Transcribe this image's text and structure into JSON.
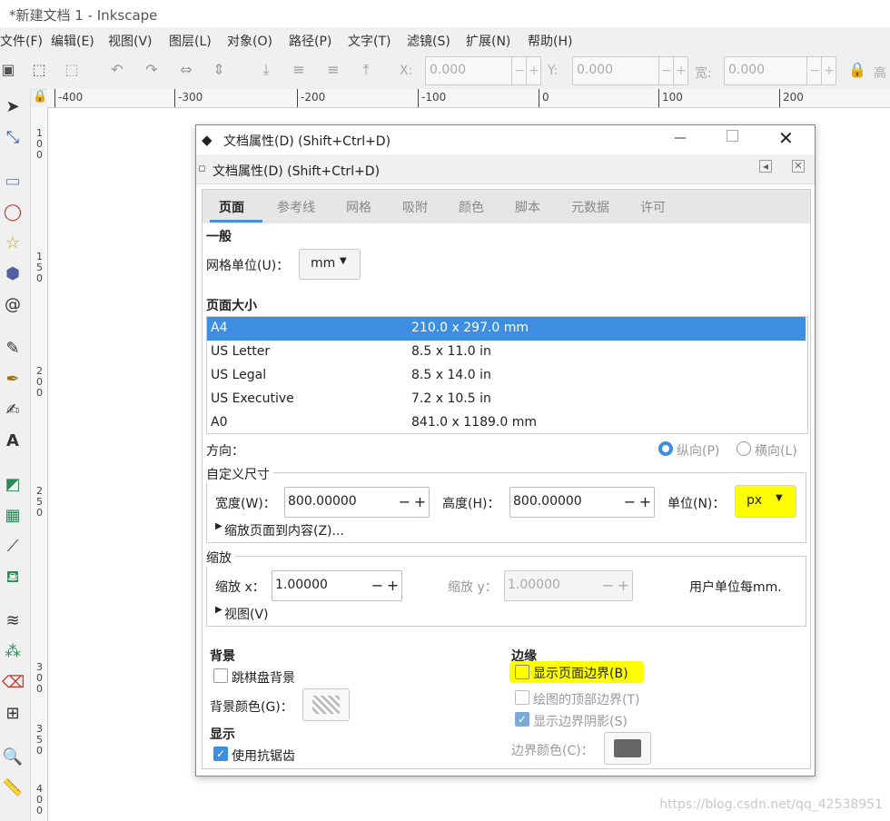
{
  "window": {
    "title": "*新建文档 1 - Inkscape"
  },
  "menu": [
    "文件(F)",
    "编辑(E)",
    "视图(V)",
    "图层(L)",
    "对象(O)",
    "路径(P)",
    "文字(T)",
    "滤镜(S)",
    "扩展(N)",
    "帮助(H)"
  ],
  "toolbar": {
    "x_label": "X:",
    "x_value": "0.000",
    "y_label": "Y:",
    "y_value": "0.000",
    "w_label": "宽:",
    "w_value": "0.000",
    "h_label": "高"
  },
  "ruler": {
    "ticks": [
      "-400",
      "-300",
      "-200",
      "-100",
      "0",
      "100",
      "200"
    ]
  },
  "vruler": [
    "1",
    "0",
    "0",
    "1",
    "5",
    "0",
    "2",
    "0",
    "0",
    "2",
    "5",
    "0",
    "3",
    "0",
    "0",
    "3",
    "5",
    "0",
    "4",
    "0",
    "0"
  ],
  "dialog": {
    "title": "文档属性(D) (Shift+Ctrl+D)",
    "subtitle": "文档属性(D) (Shift+Ctrl+D)",
    "tabs": [
      "页面",
      "参考线",
      "网格",
      "吸附",
      "颜色",
      "脚本",
      "元数据",
      "许可"
    ],
    "general_heading": "一般",
    "grid_unit_label": "网格单位(U)：",
    "grid_unit_value": "mm",
    "page_size_heading": "页面大小",
    "page_sizes": [
      {
        "name": "A4",
        "size": "210.0 x 297.0 mm"
      },
      {
        "name": "US Letter",
        "size": "8.5 x 11.0 in"
      },
      {
        "name": "US Legal",
        "size": "8.5 x 14.0 in"
      },
      {
        "name": "US Executive",
        "size": "7.2 x 10.5 in"
      },
      {
        "name": "A0",
        "size": "841.0 x 1189.0 mm"
      }
    ],
    "orientation_label": "方向：",
    "portrait": "纵向(P)",
    "landscape": "横向(L)",
    "custom_size_heading": "自定义尺寸",
    "width_label": "宽度(W)：",
    "width_value": "800.00000",
    "height_label": "高度(H)：",
    "height_value": "800.00000",
    "unit_label": "单位(N)：",
    "unit_value": "px",
    "fit_page": "缩放页面到内容(Z)...",
    "scale_heading": "缩放",
    "scale_x_label": "缩放 x：",
    "scale_x_value": "1.00000",
    "scale_y_label": "缩放 y：",
    "scale_y_value": "1.00000",
    "user_units": "用户单位每mm.",
    "viewbox": "视图(V)",
    "background_heading": "背景",
    "checkerboard": "跳棋盘背景",
    "bg_color_label": "背景颜色(G)：",
    "display_heading": "显示",
    "antialias": "使用抗锯齿",
    "border_heading": "边缘",
    "show_border": "显示页面边界(B)",
    "border_on_top": "绘图的顶部边界(T)",
    "border_shadow": "显示边界阴影(S)",
    "border_color_label": "边界颜色(C)："
  },
  "watermark": "https://blog.csdn.net/qq_42538951",
  "colors": {
    "accent": "#3d8ee0",
    "highlight": "#ffff00",
    "border_color": "#666666"
  }
}
